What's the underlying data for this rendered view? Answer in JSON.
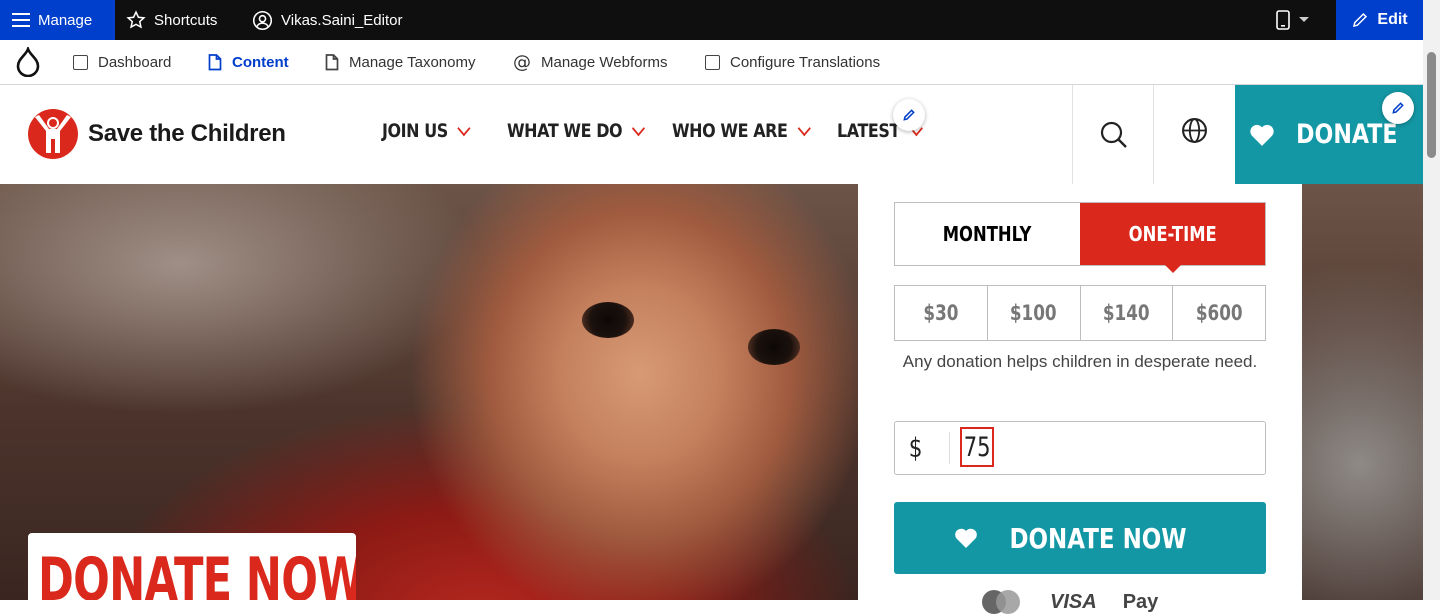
{
  "toolbar": {
    "manage_label": "Manage",
    "shortcuts_label": "Shortcuts",
    "user_label": "Vikas.Saini_Editor",
    "edit_label": "Edit"
  },
  "admin_tray": {
    "items": [
      {
        "label": "Dashboard"
      },
      {
        "label": "Content"
      },
      {
        "label": "Manage Taxonomy"
      },
      {
        "label": "Manage Webforms"
      },
      {
        "label": "Configure Translations"
      }
    ],
    "active": "Content"
  },
  "site_header": {
    "logo_text": "Save the Children",
    "nav": [
      {
        "label": "JOIN US"
      },
      {
        "label": "WHAT WE DO"
      },
      {
        "label": "WHO WE ARE"
      },
      {
        "label": "LATEST"
      }
    ],
    "donate_label": "DONATE"
  },
  "hero": {
    "cta_label": "DONATE NOW"
  },
  "donation_form": {
    "frequency": [
      {
        "label": "MONTHLY"
      },
      {
        "label": "ONE-TIME"
      }
    ],
    "selected_frequency": "ONE-TIME",
    "amounts": [
      {
        "label": "$30"
      },
      {
        "label": "$100"
      },
      {
        "label": "$140"
      },
      {
        "label": "$600"
      }
    ],
    "helper_text": "Any donation helps children in desperate need.",
    "currency_symbol": "$",
    "amount_value": "75",
    "submit_label": "DONATE NOW",
    "payment_labels": [
      "VISA",
      "Pay"
    ]
  },
  "colors": {
    "admin_blue": "#003ecc",
    "brand_red": "#da291c",
    "brand_teal": "#1397a4"
  }
}
